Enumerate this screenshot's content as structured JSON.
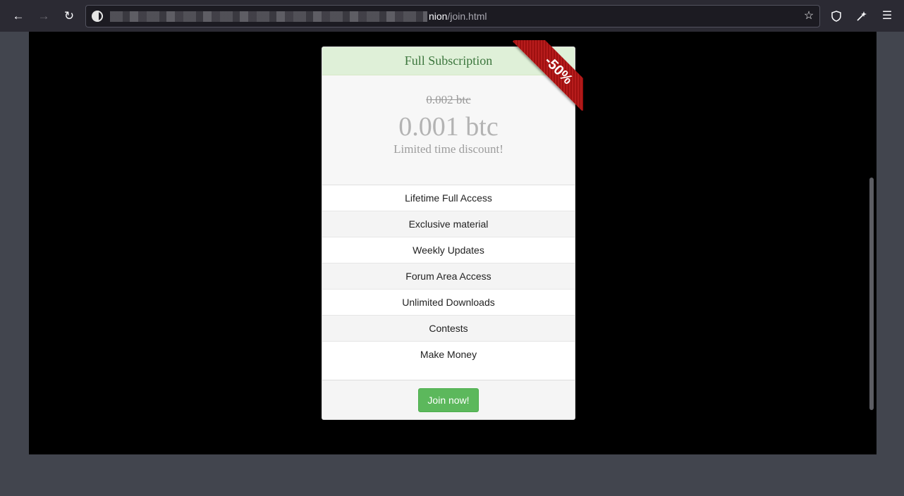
{
  "browser": {
    "url_visible": "nion",
    "url_path": "/join.html",
    "icons": {
      "back": "arrow-left-icon",
      "forward": "arrow-right-icon",
      "reload": "reload-icon",
      "bookmark": "star-icon",
      "shield": "shield-icon",
      "extensions": "magic-wand-icon",
      "menu": "hamburger-menu-icon"
    }
  },
  "plan": {
    "title": "Full Subscription",
    "old_price": "0.002 btc",
    "new_price": "0.001 btc",
    "note": "Limited time discount!",
    "badge": "-50%",
    "features": [
      "Lifetime Full Access",
      "Exclusive material",
      "Weekly Updates",
      "Forum Area Access",
      "Unlimited Downloads",
      "Contests",
      "Make Money"
    ],
    "cta": "Join now!"
  },
  "colors": {
    "header_bg": "#dff0d8",
    "header_text": "#3c763d",
    "button_bg": "#5cb85c",
    "ribbon_bg": "#b71c1c"
  }
}
